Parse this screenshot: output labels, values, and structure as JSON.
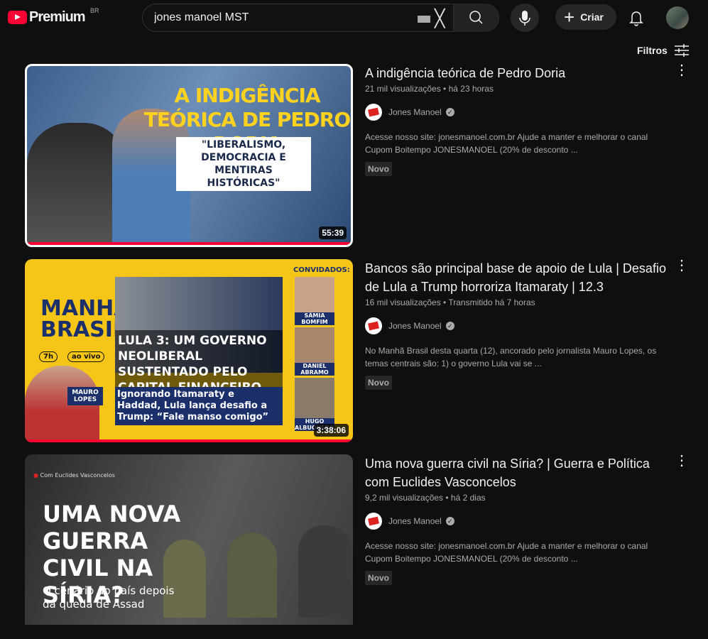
{
  "header": {
    "logo": "Premium",
    "region": "BR",
    "search_value": "jones manoel MST",
    "create_label": "Criar"
  },
  "filters_label": "Filtros",
  "videos": [
    {
      "title": "A indigência teórica de Pedro Doria",
      "views": "21 mil visualizações",
      "time": "há 23 horas",
      "channel": "Jones Manoel",
      "description": "Acesse nosso site: jonesmanoel.com.br Ajude a manter e melhorar o canal Cupom Boitempo JONESMANOEL (20% de desconto ...",
      "badge": "Novo",
      "duration": "55:39",
      "progress": 100,
      "thumb_text": {
        "headline": "A INDIGÊNCIA TEÓRICA DE PEDRO DORIA",
        "quote": "\"LIBERALISMO, DEMOCRACIA E MENTIRAS HISTÓRICAS\""
      }
    },
    {
      "title": "Bancos são principal base de apoio de Lula | Desafio de Lula a Trump horroriza Itamaraty | 12.3",
      "views": "16 mil visualizações",
      "time": "Transmitido há 7 horas",
      "channel": "Jones Manoel",
      "description": "No Manhã Brasil desta quarta (12), ancorado pelo jornalista Mauro Lopes, os temas centrais são: 1) o governo Lula vai se ...",
      "badge": "Novo",
      "duration": "3:38:06",
      "progress": 100,
      "thumb_text": {
        "show": "MANHÃ BRASIL",
        "time": "7h",
        "live": "ao vivo",
        "host": "MAURO LOPES",
        "headline": "LULA 3: UM GOVERNO NEOLIBERAL SUSTENTADO PELO CAPITAL FINANCEIRO",
        "sub": "Ignorando Itamaraty e Haddad, Lula lança desafio a Trump: “Fale manso comigo”",
        "guests_label": "CONVIDADOS:",
        "guests": [
          "SÂMIA BOMFIM",
          "DANIEL ABRAMO",
          "HUGO ALBUQUERQUE"
        ]
      }
    },
    {
      "title": "Uma nova guerra civil na Síria? | Guerra e Política com Euclides Vasconcelos",
      "views": "9,2 mil visualizações",
      "time": "há 2 dias",
      "channel": "Jones Manoel",
      "description": "Acesse nosso site: jonesmanoel.com.br Ajude a manter e melhorar o canal Cupom Boitempo JONESMANOEL (20% de desconto ...",
      "badge": "Novo",
      "thumb_text": {
        "tag": "Com Euclides Vasconcelos",
        "headline": "UMA NOVA GUERRA CIVIL NA SÍRIA?",
        "sub": "O cenário do país depois da queda de Assad"
      }
    }
  ]
}
